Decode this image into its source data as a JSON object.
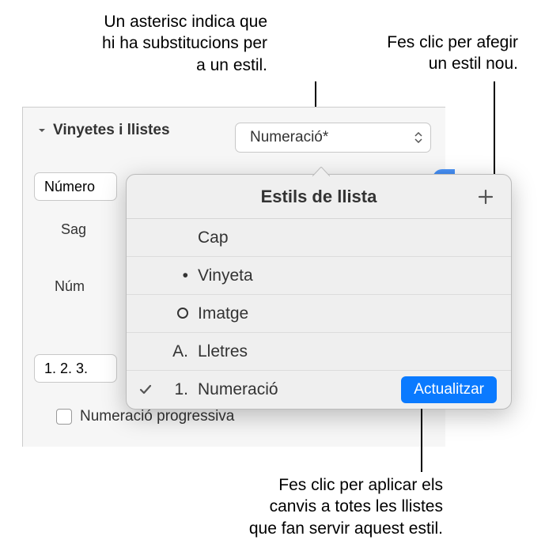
{
  "callouts": {
    "asterisk": "Un asterisc indica que\nhi ha substitucions per\na un estil.",
    "add_new": "Fes clic per afegir\nun estil nou.",
    "update": "Fes clic per aplicar els\ncanvis a totes les llistes\nque fan servir aquest estil."
  },
  "panel": {
    "section_title": "Vinyetes i llistes",
    "current_style": "Numeració*",
    "partial_label_numero": "Número",
    "label_sagnat": "Sag",
    "label_numeros": "Núm",
    "ordering": "1. 2. 3.",
    "checkbox_progressive": "Numeració progressiva"
  },
  "popover": {
    "title": "Estils de llista",
    "items": [
      {
        "marker": "",
        "label": "Cap",
        "selected": false
      },
      {
        "marker": "•",
        "label": "Vinyeta",
        "selected": false
      },
      {
        "marker": "img",
        "label": "Imatge",
        "selected": false
      },
      {
        "marker": "A.",
        "label": "Lletres",
        "selected": false
      },
      {
        "marker": "1.",
        "label": "Numeració",
        "selected": true
      }
    ],
    "update_label": "Actualitzar"
  }
}
